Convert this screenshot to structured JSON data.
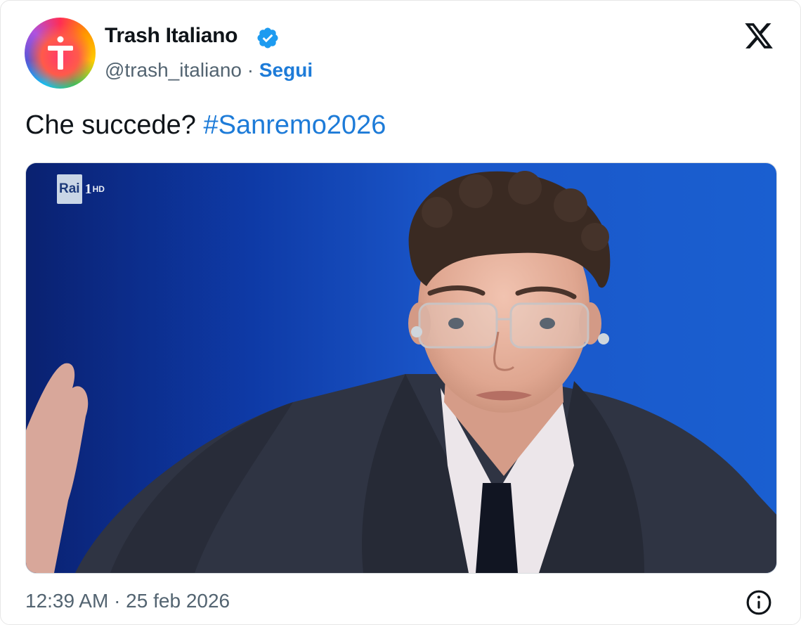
{
  "account": {
    "name": "Trash Italiano",
    "handle": "@trash_italiano",
    "separator": "·",
    "follow_label": "Segui"
  },
  "icons": {
    "avatar": "trash-italiano-logo",
    "verified": "verified-badge-icon",
    "platform": "x-logo-icon",
    "info": "info-icon"
  },
  "tweet": {
    "text": "Che succede?",
    "hashtag": "#Sanremo2026"
  },
  "media": {
    "channel_brand": "Rai",
    "channel_number": "1",
    "channel_quality": "HD"
  },
  "meta": {
    "timestamp": "12:39 AM · 25 feb 2026"
  },
  "colors": {
    "accent": "#1d7bd8",
    "text": "#0f1419",
    "muted": "#536471"
  }
}
